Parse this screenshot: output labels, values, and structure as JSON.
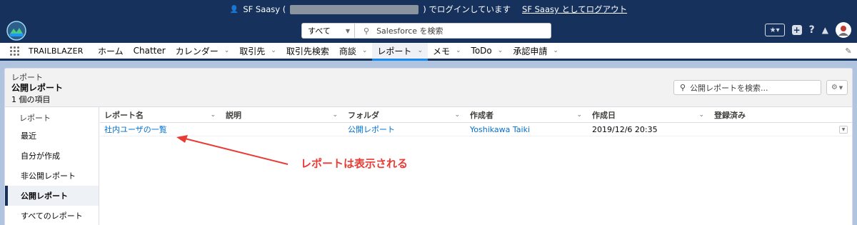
{
  "impersonation": {
    "prefix": "SF Saasy (",
    "suffix": ") でログインしています",
    "logout": "SF Saasy としてログアウト"
  },
  "header": {
    "search": {
      "scope": "すべて",
      "placeholder": "Salesforce を検索"
    }
  },
  "nav": {
    "app_name": "TRAILBLAZER",
    "tabs": [
      {
        "label": "ホーム",
        "dropdown": false,
        "active": false
      },
      {
        "label": "Chatter",
        "dropdown": false,
        "active": false
      },
      {
        "label": "カレンダー",
        "dropdown": true,
        "active": false
      },
      {
        "label": "取引先",
        "dropdown": true,
        "active": false
      },
      {
        "label": "取引先検索",
        "dropdown": false,
        "active": false
      },
      {
        "label": "商談",
        "dropdown": true,
        "active": false
      },
      {
        "label": "レポート",
        "dropdown": true,
        "active": true
      },
      {
        "label": "メモ",
        "dropdown": true,
        "active": false
      },
      {
        "label": "ToDo",
        "dropdown": true,
        "active": false
      },
      {
        "label": "承認申請",
        "dropdown": true,
        "active": false
      }
    ]
  },
  "list": {
    "breadcrumb": "レポート",
    "title": "公開レポート",
    "count": "1 個の項目",
    "search_placeholder": "公開レポートを検索..."
  },
  "sidebar": {
    "heading": "レポート",
    "items": [
      {
        "label": "最近",
        "active": false
      },
      {
        "label": "自分が作成",
        "active": false
      },
      {
        "label": "非公開レポート",
        "active": false
      },
      {
        "label": "公開レポート",
        "active": true
      },
      {
        "label": "すべてのレポート",
        "active": false
      }
    ]
  },
  "table": {
    "columns": [
      "レポート名",
      "説明",
      "フォルダ",
      "作成者",
      "作成日",
      "登録済み"
    ],
    "rows": [
      {
        "name": "社内ユーザの一覧",
        "description": "",
        "folder": "公開レポート",
        "created_by": "Yoshikawa Taiki",
        "created_date": "2019/12/6 20:35",
        "subscribed": ""
      }
    ]
  },
  "annotation": {
    "text": "レポートは表示される",
    "color": "#ea3a34"
  },
  "colors": {
    "header": "#16325c",
    "link": "#0070d2",
    "active_tab": "#1589ee"
  }
}
